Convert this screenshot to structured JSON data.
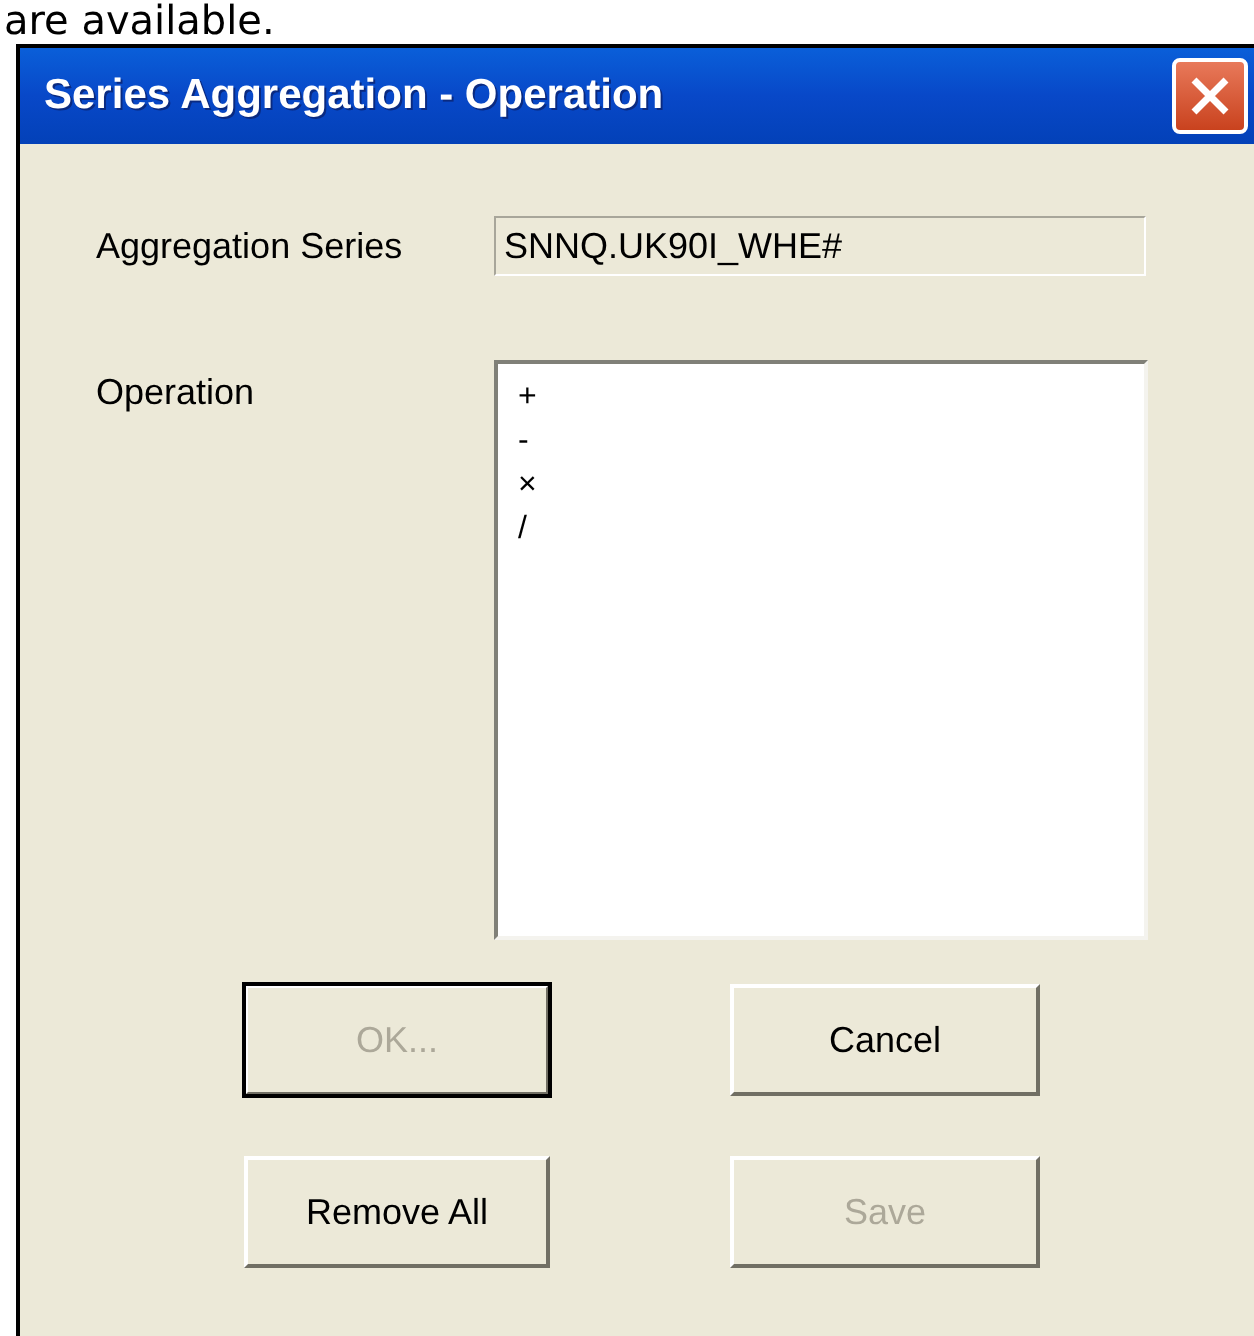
{
  "caption": "are available.",
  "window": {
    "title": "Series Aggregation - Operation"
  },
  "aggregation_series": {
    "label": "Aggregation Series",
    "value": "SNNQ.UK90I_WHE#"
  },
  "operation": {
    "label": "Operation",
    "items": [
      {
        "label": "+",
        "selected": false
      },
      {
        "label": "-",
        "selected": false
      },
      {
        "label": "×",
        "selected": false
      },
      {
        "label": "/",
        "selected": false
      }
    ]
  },
  "buttons": [
    {
      "label": "OK...",
      "disabled": true,
      "default": true
    },
    {
      "label": "Cancel",
      "disabled": false,
      "default": false
    },
    {
      "label": "Remove All",
      "disabled": false,
      "default": false
    },
    {
      "label": "Save",
      "disabled": true,
      "default": false
    }
  ]
}
